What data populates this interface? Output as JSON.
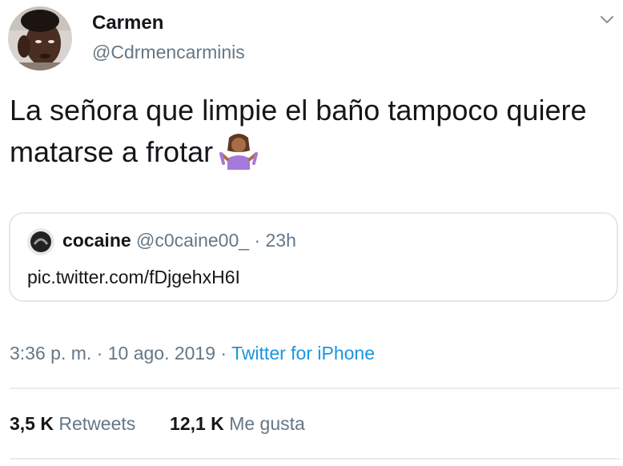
{
  "author": {
    "name": "Carmen",
    "handle": "@Cdrmencarminis"
  },
  "tweet": {
    "text": "La señora que limpie el baño tampoco quiere matarse a frotar",
    "emoji": "person-shrugging-emoji"
  },
  "quoted": {
    "name": "cocaine",
    "handle": "@c0caine00_",
    "separator": "·",
    "time": "23h",
    "link": "pic.twitter.com/fDjgehxH6I"
  },
  "meta": {
    "timestamp": "3:36 p. m. · 10 ago. 2019 · ",
    "source": "Twitter for iPhone"
  },
  "stats": {
    "retweets_count": "3,5 K",
    "retweets_label": "Retweets",
    "likes_count": "12,1 K",
    "likes_label": "Me gusta"
  },
  "colors": {
    "text": "#14171a",
    "secondary": "#657786",
    "link": "#1b95e0",
    "border": "#e1e8ed"
  }
}
